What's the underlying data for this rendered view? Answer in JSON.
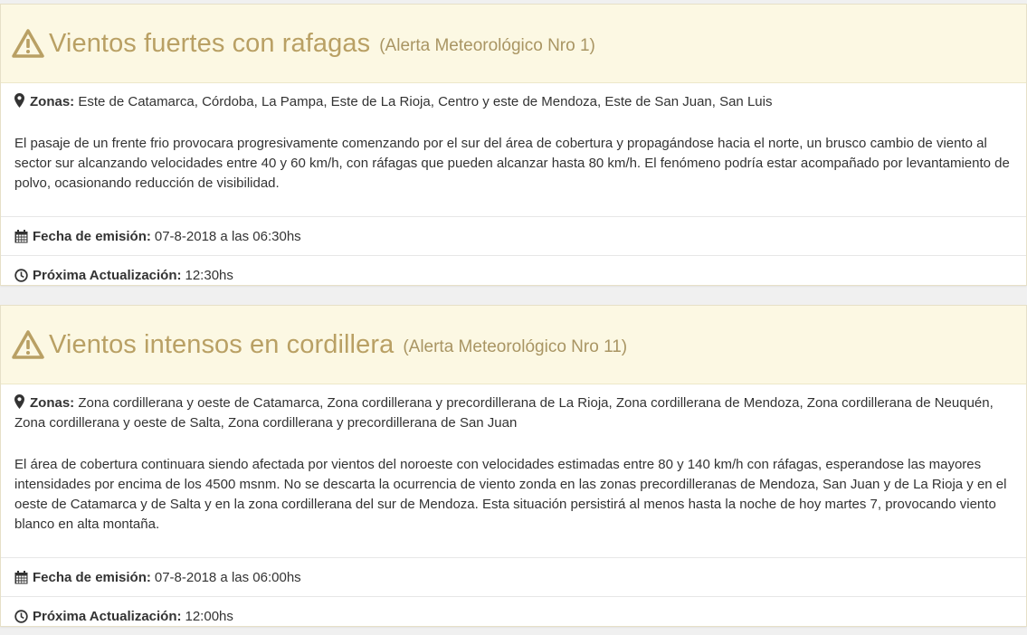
{
  "alerts": [
    {
      "title": "Vientos fuertes con rafagas",
      "subtitle": "(Alerta Meteorológico Nro 1)",
      "zones_label": "Zonas:",
      "zones": "Este de Catamarca, Córdoba, La Pampa, Este de La Rioja, Centro y este de Mendoza, Este de San Juan, San Luis",
      "description": "El pasaje de un frente frio provocara progresivamente comenzando por el sur del área de cobertura y propagándose hacia el norte, un brusco cambio de viento al sector sur alcanzando velocidades entre 40 y 60 km/h, con ráfagas que pueden alcanzar hasta 80 km/h. El fenómeno podría estar acompañado por levantamiento de polvo, ocasionando reducción de visibilidad.",
      "emission_label": "Fecha de emisión:",
      "emission": "07-8-2018 a las 06:30hs",
      "update_label": "Próxima Actualización:",
      "update": "12:30hs"
    },
    {
      "title": "Vientos intensos en cordillera",
      "subtitle": "(Alerta Meteorológico Nro 11)",
      "zones_label": "Zonas:",
      "zones": "Zona cordillerana y oeste de Catamarca, Zona cordillerana y precordillerana de La Rioja, Zona cordillerana de Mendoza, Zona cordillerana de Neuquén, Zona cordillerana y oeste de Salta, Zona cordillerana y precordillerana de San Juan",
      "description": "El área de cobertura continuara siendo afectada por vientos del noroeste con velocidades estimadas entre 80 y 140 km/h con ráfagas, esperandose las mayores intensidades por encima de los 4500 msnm. No se descarta la ocurrencia de viento zonda en las zonas precordilleranas de Mendoza, San Juan y de La Rioja y en el oeste de Catamarca y de Salta y en la zona cordillerana del sur de Mendoza. Esta situación persistirá al menos hasta la noche de hoy martes 7, provocando viento blanco en alta montaña.",
      "emission_label": "Fecha de emisión:",
      "emission": "07-8-2018 a las 06:00hs",
      "update_label": "Próxima Actualización:",
      "update": "12:00hs"
    }
  ],
  "icons": {
    "heading": "warning-icon",
    "zones": "map-marker-icon",
    "emission": "calendar-icon",
    "update": "clock-icon"
  },
  "colors": {
    "heading_bg": "#fcf8e3",
    "heading_text": "#b9a064",
    "body_text": "#333333"
  }
}
